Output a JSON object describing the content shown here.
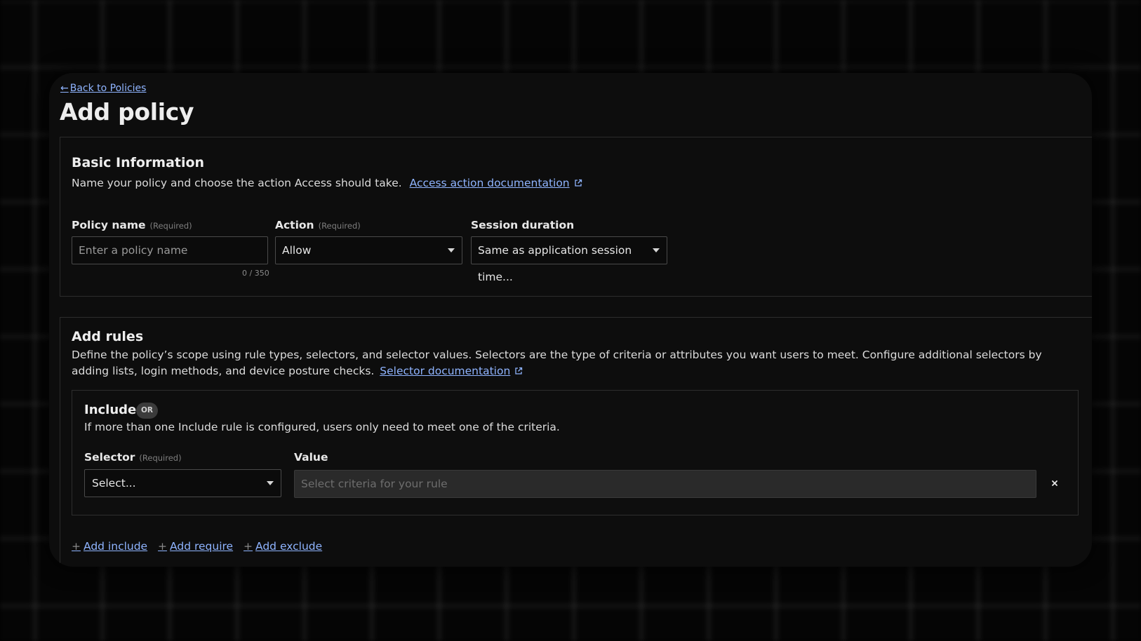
{
  "nav": {
    "back_arrow": "←",
    "back_label": "Back to Policies"
  },
  "page": {
    "title": "Add policy"
  },
  "basic": {
    "title": "Basic Information",
    "description": "Name your policy and choose the action Access should take.",
    "doc_link": "Access action documentation",
    "doc_link_icon": "external-link-icon",
    "policy_name": {
      "label": "Policy name",
      "required": "(Required)",
      "placeholder": "Enter a policy name",
      "value": "",
      "counter": "0 / 350"
    },
    "action": {
      "label": "Action",
      "required": "(Required)",
      "selected": "Allow"
    },
    "session": {
      "label": "Session duration",
      "selected": "Same as application session time..."
    }
  },
  "rules": {
    "title": "Add rules",
    "description": "Define the policy’s scope using rule types, selectors, and selector values. Selectors are the type of criteria or attributes you want users to meet. Configure additional selectors by adding lists, login methods, and device posture checks.",
    "doc_link": "Selector documentation",
    "include": {
      "title": "Include",
      "badge": "OR",
      "description": "If more than one Include rule is configured, users only need to meet one of the criteria.",
      "selector_label": "Selector",
      "selector_required": "(Required)",
      "selector_value": "Select...",
      "value_label": "Value",
      "value_placeholder": "Select criteria for your rule",
      "remove_icon": "close-icon"
    },
    "actions": {
      "plus": "+",
      "add_include": "Add include",
      "add_require": "Add require",
      "add_exclude": "Add exclude"
    }
  },
  "colors": {
    "link": "#8fb4ff",
    "panel_bg": "#0d0d0d",
    "border": "#2c2c2c",
    "disabled_input": "#2a2a2a"
  }
}
